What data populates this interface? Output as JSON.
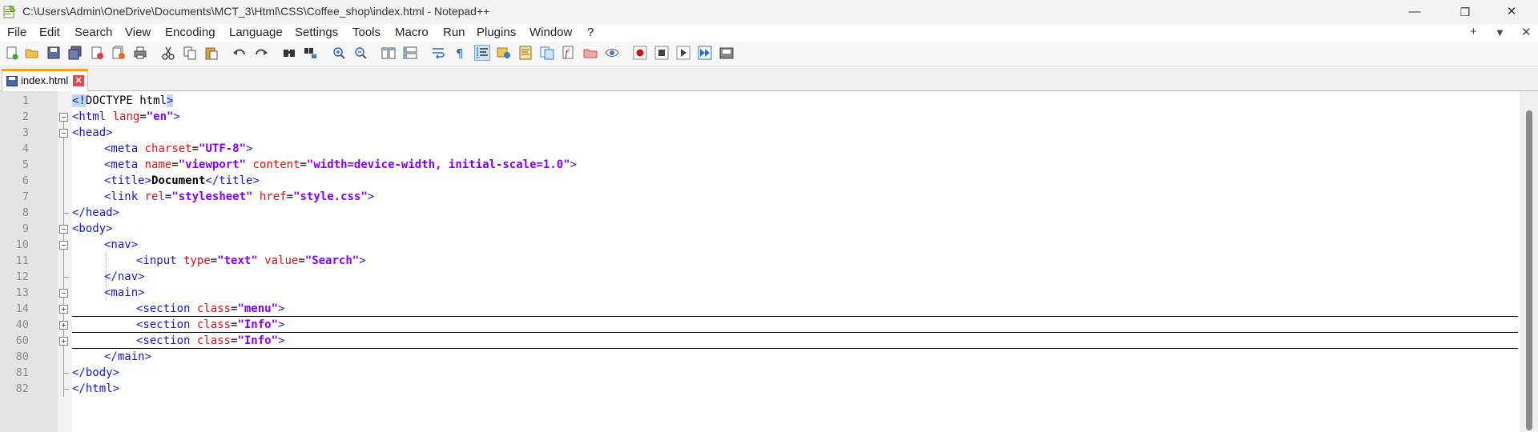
{
  "window": {
    "title": "C:\\Users\\Admin\\OneDrive\\Documents\\MCT_3\\Html\\CSS\\Coffee_shop\\index.html - Notepad++",
    "minimize": "—",
    "restore": "❐",
    "close": "✕"
  },
  "menu": {
    "items": [
      "File",
      "Edit",
      "Search",
      "View",
      "Encoding",
      "Language",
      "Settings",
      "Tools",
      "Macro",
      "Run",
      "Plugins",
      "Window",
      "?"
    ],
    "right": [
      "+",
      "▼",
      "✕"
    ]
  },
  "toolbar": {
    "icons": [
      "new-file-icon",
      "open-file-icon",
      "save-icon",
      "save-all-icon",
      "close-icon",
      "close-all-icon",
      "print-icon",
      "cut-icon",
      "copy-icon",
      "paste-icon",
      "undo-icon",
      "redo-icon",
      "find-icon",
      "replace-icon",
      "zoom-in-icon",
      "zoom-out-icon",
      "sync-vertical-icon",
      "sync-horizontal-icon",
      "word-wrap-icon",
      "show-all-chars-icon",
      "indent-guide-icon",
      "udl-icon",
      "doc-map-icon",
      "function-list-icon",
      "folder-workspace-icon",
      "monitoring-icon",
      "eye-icon",
      "record-macro-icon",
      "stop-record-icon",
      "play-macro-icon",
      "run-macro-multiple-icon",
      "save-macro-icon"
    ]
  },
  "tab": {
    "label": "index.html"
  },
  "editor": {
    "line_numbers": [
      "1",
      "2",
      "3",
      "4",
      "5",
      "6",
      "7",
      "8",
      "9",
      "10",
      "11",
      "12",
      "13",
      "14",
      "40",
      "60",
      "80",
      "81",
      "82"
    ],
    "lines": {
      "l1": {
        "open": "<!",
        "doctype": "DOCTYPE html",
        "close": ">"
      },
      "l2": {
        "t1": "<html",
        "a1": " lang",
        "eq": "=",
        "v1": "\"en\"",
        "t2": ">"
      },
      "l3": {
        "t1": "<head>"
      },
      "l4": {
        "t1": "<meta",
        "a1": " charset",
        "eq": "=",
        "v1": "\"UTF-8\"",
        "t2": ">"
      },
      "l5": {
        "t1": "<meta",
        "a1": " name",
        "eq1": "=",
        "v1": "\"viewport\"",
        "a2": " content",
        "eq2": "=",
        "v2": "\"width=device-width, initial-scale=1.0\"",
        "t2": ">"
      },
      "l6": {
        "t1": "<title>",
        "text": "Document",
        "t2": "</title>"
      },
      "l7": {
        "t1": "<link",
        "a1": " rel",
        "eq1": "=",
        "v1": "\"stylesheet\"",
        "a2": " href",
        "eq2": "=",
        "v2": "\"style.css\"",
        "t2": ">"
      },
      "l8": {
        "t1": "</head>"
      },
      "l9": {
        "t1": "<body>"
      },
      "l10": {
        "t1": "<nav>"
      },
      "l11": {
        "t1": "<input",
        "a1": " type",
        "eq1": "=",
        "v1": "\"text\"",
        "a2": " value",
        "eq2": "=",
        "v2": "\"Search\"",
        "t2": ">"
      },
      "l12": {
        "t1": "</nav>"
      },
      "l13": {
        "t1": "<main>"
      },
      "l14": {
        "t1": "<section",
        "a1": " class",
        "eq": "=",
        "v1": "\"menu\"",
        "t2": ">"
      },
      "l40": {
        "t1": "<section",
        "a1": " class",
        "eq": "=",
        "v1": "\"Info\"",
        "t2": ">"
      },
      "l60": {
        "t1": "<section",
        "a1": " class",
        "eq": "=",
        "v1": "\"Info\"",
        "t2": ">"
      },
      "l80": {
        "t1": "</main>"
      },
      "l81": {
        "t1": "</body>"
      },
      "l82": {
        "t1": "</html>"
      }
    }
  }
}
